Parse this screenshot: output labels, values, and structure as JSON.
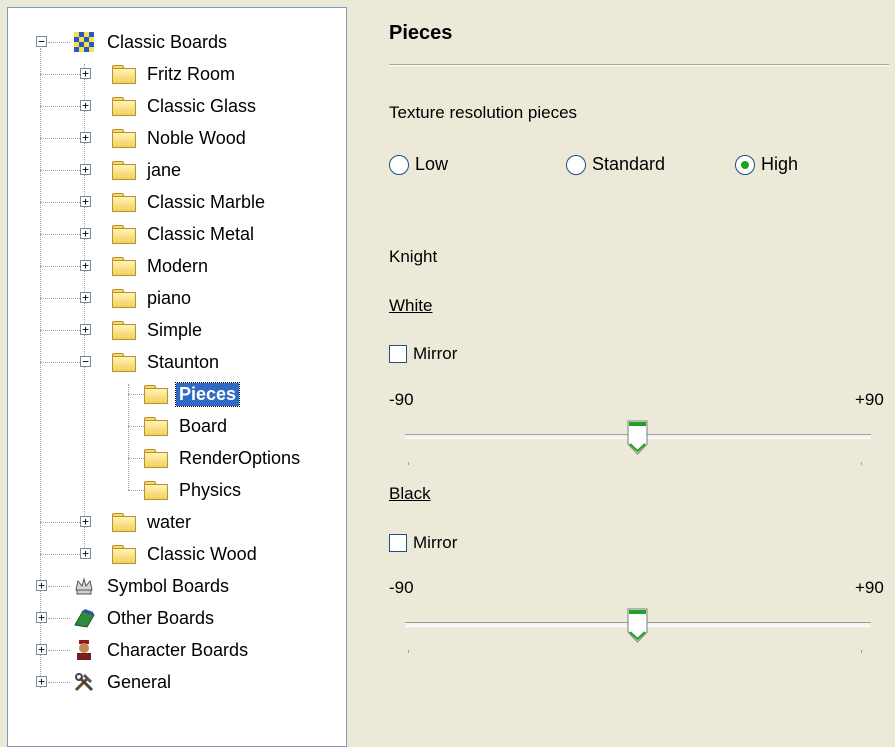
{
  "tree": {
    "root": [
      {
        "label": "Classic Boards",
        "icon": "checkerboard-icon",
        "expanded": true
      },
      {
        "label": "Symbol Boards",
        "icon": "crown-icon",
        "expanded": false
      },
      {
        "label": "Other Boards",
        "icon": "board-icon",
        "expanded": false
      },
      {
        "label": "Character Boards",
        "icon": "character-icon",
        "expanded": false
      },
      {
        "label": "General",
        "icon": "tools-icon",
        "expanded": false
      }
    ],
    "classic_children": [
      "Fritz Room",
      "Classic Glass",
      "Noble Wood",
      "jane",
      "Classic Marble",
      "Classic Metal",
      "Modern",
      "piano",
      "Simple",
      "Staunton",
      "water",
      "Classic Wood"
    ],
    "staunton_children": [
      "Pieces",
      "Board",
      "RenderOptions",
      "Physics"
    ],
    "selected": "Pieces"
  },
  "panel": {
    "heading": "Pieces",
    "texture_label": "Texture resolution pieces",
    "radios": [
      {
        "label": "Low",
        "checked": false
      },
      {
        "label": "Standard",
        "checked": false
      },
      {
        "label": "High",
        "checked": true
      }
    ],
    "piece_name": "Knight",
    "white": {
      "title": "White",
      "mirror_label": "Mirror",
      "mirror_checked": false,
      "min_label": "-90",
      "max_label": "+90",
      "value": 0
    },
    "black": {
      "title": "Black",
      "mirror_label": "Mirror",
      "mirror_checked": false,
      "min_label": "-90",
      "max_label": "+90",
      "value": 0
    }
  },
  "colors": {
    "window_bg": "#ece9d8",
    "selection": "#316ac5",
    "radio_dot": "#21a121",
    "slider_thumb": "#5cb85c"
  }
}
